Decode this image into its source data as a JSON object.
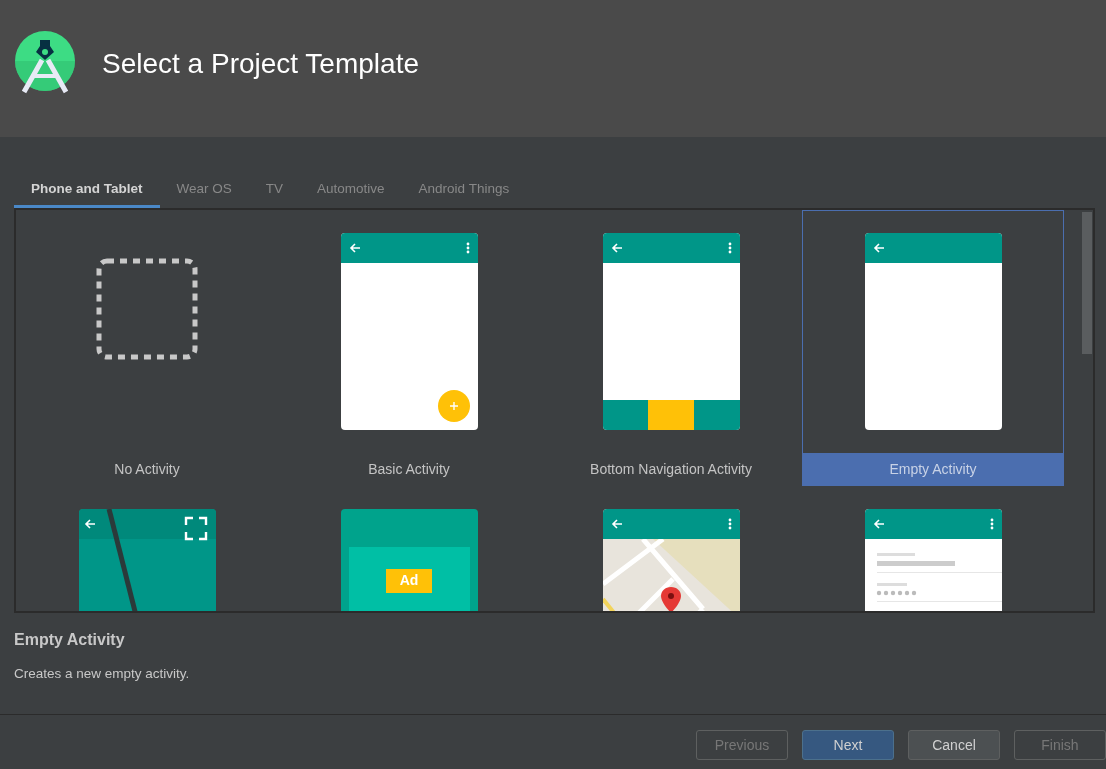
{
  "header": {
    "title": "Select a Project Template"
  },
  "tabs": [
    {
      "label": "Phone and Tablet",
      "selected": true
    },
    {
      "label": "Wear OS",
      "selected": false
    },
    {
      "label": "TV",
      "selected": false
    },
    {
      "label": "Automotive",
      "selected": false
    },
    {
      "label": "Android Things",
      "selected": false
    }
  ],
  "templates": [
    {
      "kind": "none",
      "label": "No Activity",
      "selected": false
    },
    {
      "kind": "basic",
      "label": "Basic Activity",
      "selected": false
    },
    {
      "kind": "bottom_nav",
      "label": "Bottom Navigation Activity",
      "selected": false
    },
    {
      "kind": "empty",
      "label": "Empty Activity",
      "selected": true
    },
    {
      "kind": "fullscreen",
      "selected": false
    },
    {
      "kind": "ad",
      "preview_text": "Ad",
      "selected": false
    },
    {
      "kind": "map",
      "selected": false
    },
    {
      "kind": "settings",
      "selected": false
    }
  ],
  "description": {
    "title": "Empty Activity",
    "text": "Creates a new empty activity."
  },
  "buttons": [
    {
      "label": "Previous",
      "disabled": true,
      "default": false
    },
    {
      "label": "Next",
      "disabled": false,
      "default": true
    },
    {
      "label": "Cancel",
      "disabled": false,
      "default": false
    },
    {
      "label": "Finish",
      "disabled": true,
      "default": false
    }
  ]
}
